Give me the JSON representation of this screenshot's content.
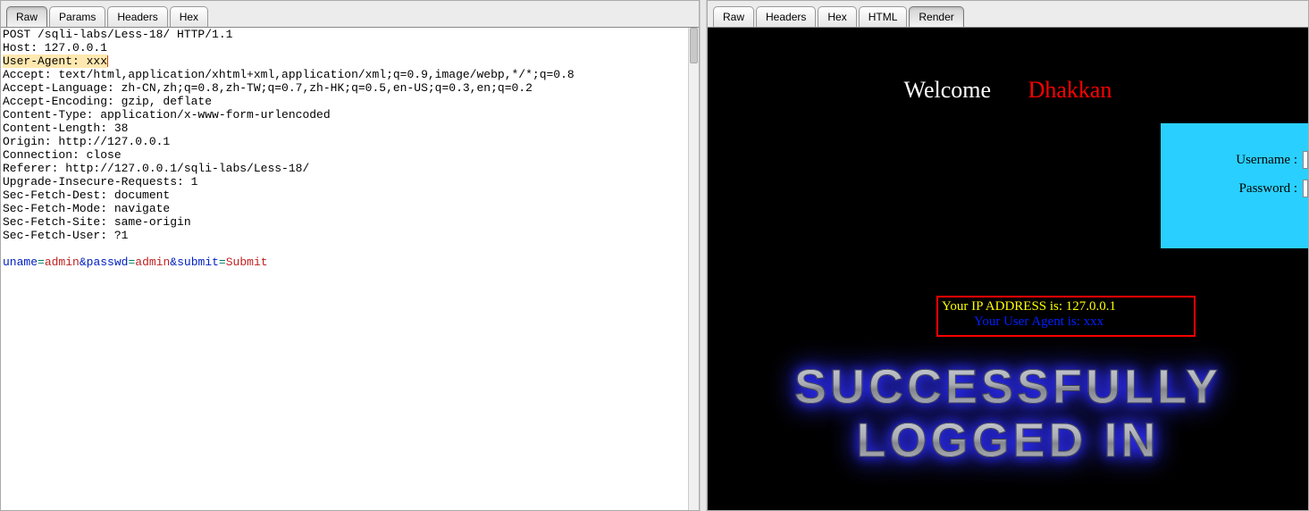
{
  "left": {
    "tabs": [
      "Raw",
      "Params",
      "Headers",
      "Hex"
    ],
    "active_tab": 0,
    "request_line": "POST /sqli-labs/Less-18/ HTTP/1.1",
    "headers": [
      "Host: 127.0.0.1",
      "User-Agent: xxx",
      "Accept: text/html,application/xhtml+xml,application/xml;q=0.9,image/webp,*/*;q=0.8",
      "Accept-Language: zh-CN,zh;q=0.8,zh-TW;q=0.7,zh-HK;q=0.5,en-US;q=0.3,en;q=0.2",
      "Accept-Encoding: gzip, deflate",
      "Content-Type: application/x-www-form-urlencoded",
      "Content-Length: 38",
      "Origin: http://127.0.0.1",
      "Connection: close",
      "Referer: http://127.0.0.1/sqli-labs/Less-18/",
      "Upgrade-Insecure-Requests: 1",
      "Sec-Fetch-Dest: document",
      "Sec-Fetch-Mode: navigate",
      "Sec-Fetch-Site: same-origin",
      "Sec-Fetch-User: ?1"
    ],
    "ua_header_index": 1,
    "body_params": [
      {
        "k": "uname",
        "v": "admin"
      },
      {
        "k": "passwd",
        "v": "admin"
      },
      {
        "k": "submit",
        "v": "Submit"
      }
    ]
  },
  "right": {
    "tabs": [
      "Raw",
      "Headers",
      "Hex",
      "HTML",
      "Render"
    ],
    "active_tab": 4,
    "welcome": "Welcome   ",
    "dhakkan": "Dhakkan",
    "form": {
      "username_lbl": "Username :",
      "password_lbl": "Password :"
    },
    "info": {
      "ip": "Your IP ADDRESS is: 127.0.0.1",
      "ua": "Your User Agent is: xxx"
    },
    "success_line1": "SUCCESSFULLY",
    "success_line2": "LOGGED IN"
  }
}
